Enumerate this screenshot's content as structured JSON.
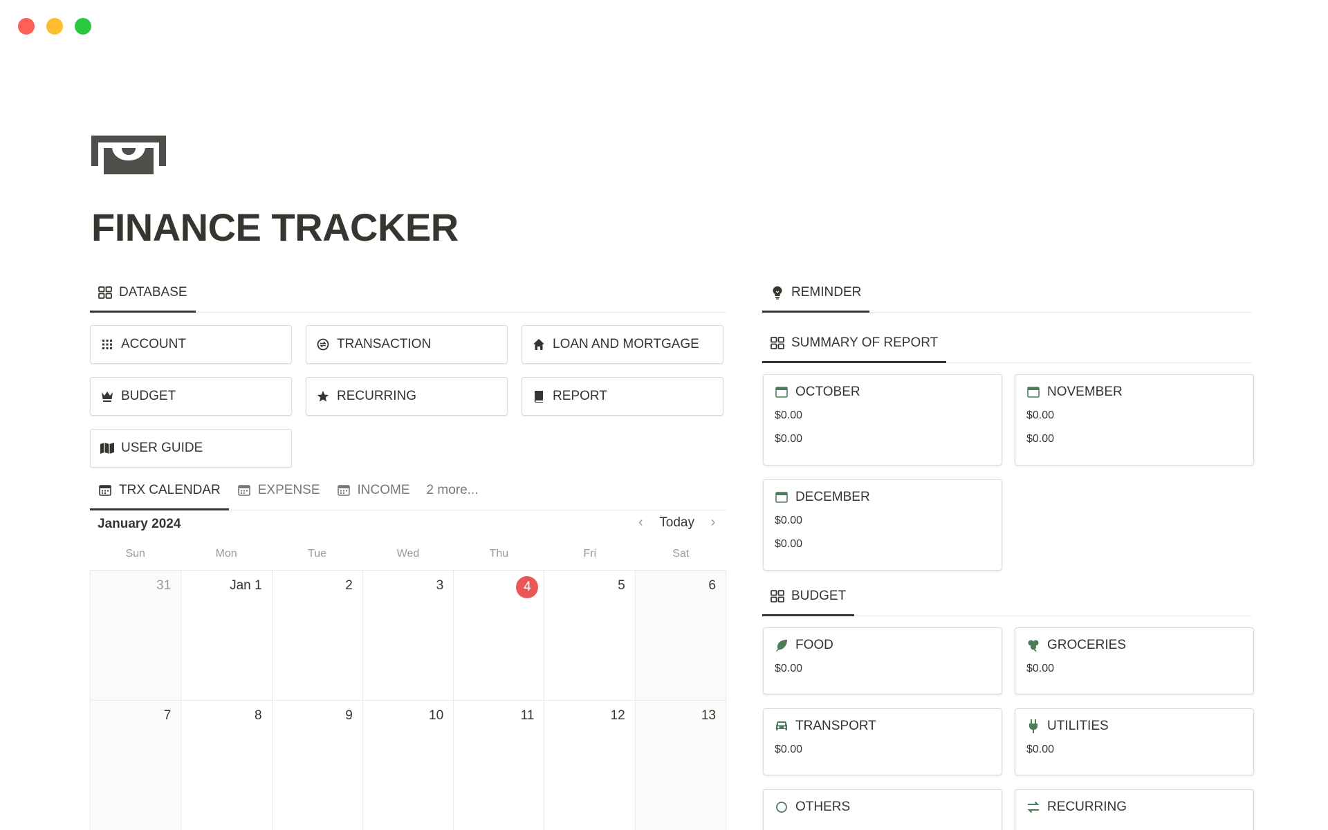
{
  "window": {
    "controls": [
      "close",
      "minimize",
      "maximize"
    ]
  },
  "page": {
    "title": "FINANCE TRACKER",
    "icon": "cash-icon"
  },
  "database": {
    "tab_label": "DATABASE",
    "buttons": [
      {
        "label": "ACCOUNT",
        "icon": "grid-dots-icon"
      },
      {
        "label": "TRANSACTION",
        "icon": "exchange-icon"
      },
      {
        "label": "LOAN AND MORTGAGE",
        "icon": "home-icon"
      },
      {
        "label": "BUDGET",
        "icon": "crown-icon"
      },
      {
        "label": "RECURRING",
        "icon": "star-icon"
      },
      {
        "label": "REPORT",
        "icon": "book-icon"
      },
      {
        "label": "USER GUIDE",
        "icon": "map-icon"
      }
    ]
  },
  "calendar_tabs": [
    {
      "label": "TRX CALENDAR",
      "active": true
    },
    {
      "label": "EXPENSE",
      "active": false
    },
    {
      "label": "INCOME",
      "active": false
    },
    {
      "label": "2 more...",
      "active": false
    }
  ],
  "calendar": {
    "month": "January 2024",
    "today_label": "Today",
    "weekdays": [
      "Sun",
      "Mon",
      "Tue",
      "Wed",
      "Thu",
      "Fri",
      "Sat"
    ],
    "days": [
      "31",
      "Jan 1",
      "2",
      "3",
      "4",
      "5",
      "6",
      "7",
      "8",
      "9",
      "10",
      "11",
      "12",
      "13"
    ],
    "today_day": "4"
  },
  "reminder": {
    "tab_label": "REMINDER"
  },
  "summary": {
    "tab_label": "SUMMARY OF REPORT",
    "cards": [
      {
        "title": "OCTOBER",
        "values": [
          "$0.00",
          "$0.00"
        ]
      },
      {
        "title": "NOVEMBER",
        "values": [
          "$0.00",
          "$0.00"
        ]
      },
      {
        "title": "DECEMBER",
        "values": [
          "$0.00",
          "$0.00"
        ]
      }
    ]
  },
  "budget": {
    "tab_label": "BUDGET",
    "cards": [
      {
        "title": "FOOD",
        "value": "$0.00",
        "icon": "leaf-icon"
      },
      {
        "title": "GROCERIES",
        "value": "$0.00",
        "icon": "shamrock-icon"
      },
      {
        "title": "TRANSPORT",
        "value": "$0.00",
        "icon": "car-icon"
      },
      {
        "title": "UTILITIES",
        "value": "$0.00",
        "icon": "plug-icon"
      },
      {
        "title": "OTHERS",
        "value": "",
        "icon": "circle-icon"
      },
      {
        "title": "RECURRING",
        "value": "",
        "icon": "repeat-icon"
      }
    ]
  },
  "colors": {
    "text": "#37352f",
    "muted": "#9b9a97",
    "today": "#eb5757",
    "accent_green": "#4a7c59"
  }
}
